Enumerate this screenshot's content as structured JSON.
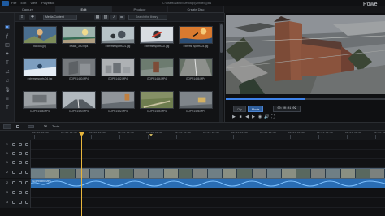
{
  "window": {
    "menu": [
      "File",
      "Edit",
      "View",
      "Playback"
    ],
    "path": "C:\\Users\\Ivanov\\Desktop\\[Untitled].pds",
    "brand": "Powe"
  },
  "tabs": [
    {
      "label": "Capture",
      "active": false
    },
    {
      "label": "Edit",
      "active": true
    },
    {
      "label": "Produce",
      "active": false
    },
    {
      "label": "Create Disc",
      "active": false
    }
  ],
  "library": {
    "dropdown_value": "Media Content",
    "search_placeholder": "Search the library",
    "items": [
      {
        "name": "balloon.jpg",
        "thumb": "balloon"
      },
      {
        "name": "beach_360.mp4",
        "thumb": "beach"
      },
      {
        "name": "extreme sports 01.jpg",
        "thumb": "bike"
      },
      {
        "name": "extreme sports 02.jpg",
        "thumb": "bike2"
      },
      {
        "name": "extreme sports 03.jpg",
        "thumb": "surf"
      },
      {
        "name": "extreme sports 04.jpg",
        "thumb": "ski"
      },
      {
        "name": "GOPR1480.MP4",
        "thumb": "gray1"
      },
      {
        "name": "GOPR1482.MP4",
        "thumb": "city"
      },
      {
        "name": "GOPR1484.MP4",
        "thumb": "aerial"
      },
      {
        "name": "GOPR1486.MP4",
        "thumb": "street"
      },
      {
        "name": "GOPR1488.MP4",
        "thumb": "gray2"
      },
      {
        "name": "GOPR1490.MP4",
        "thumb": "road"
      },
      {
        "name": "GOPR1492.MP4",
        "thumb": "rooftop"
      },
      {
        "name": "GOPR1494.MP4",
        "thumb": "park"
      },
      {
        "name": "GOPR1496.MP4",
        "thumb": "truck"
      }
    ]
  },
  "preview": {
    "clip_label": "Clip",
    "movie_label": "Movie",
    "timecode": "00:00:01:09",
    "progress": 0.5
  },
  "timeline": {
    "tools_label": "Tools",
    "ruler_labels": [
      "00:00:00:00",
      "00:00:10:00",
      "00:00:20:00",
      "00:00:30:00",
      "00:00:40:00",
      "00:00:50:00",
      "00:01:00:00",
      "00:01:10:00",
      "00:01:20:00",
      "00:01:30:00",
      "00:01:40:00",
      "00:01:50:00",
      "00:02:00:00"
    ],
    "tracks": [
      "1",
      "1",
      "1",
      "2",
      "2",
      "3",
      "3"
    ],
    "audio_clip": "GOPR1484.MP4"
  },
  "colors": {
    "accent": "#3d82e8",
    "playhead": "#e7b53c",
    "audio": "#2a6db3"
  }
}
